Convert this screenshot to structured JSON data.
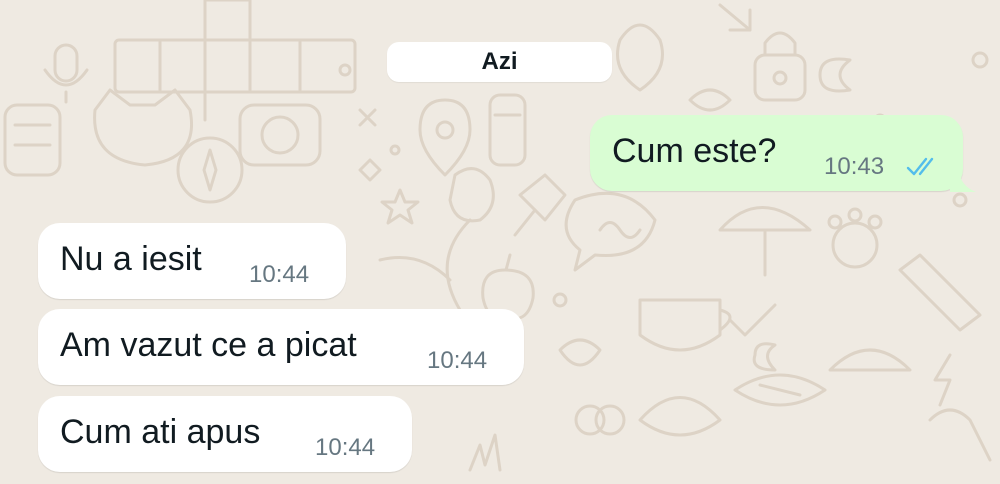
{
  "chat": {
    "date_separator": "Azi",
    "messages": [
      {
        "direction": "outgoing",
        "text": "Cum este?",
        "time": "10:43",
        "status_icon": "double-check-read-icon",
        "status_color": "#53bdeb"
      },
      {
        "direction": "incoming",
        "text": "Nu a iesit",
        "time": "10:44"
      },
      {
        "direction": "incoming",
        "text": "Am vazut ce a picat",
        "time": "10:44"
      },
      {
        "direction": "incoming",
        "text": "Cum ati apus",
        "time": "10:44"
      }
    ]
  },
  "colors": {
    "wallpaper": "#efeae2",
    "incoming_bubble": "#ffffff",
    "outgoing_bubble": "#d9fdd3",
    "text": "#111b21",
    "time": "#667781",
    "read_ticks": "#53bdeb"
  }
}
